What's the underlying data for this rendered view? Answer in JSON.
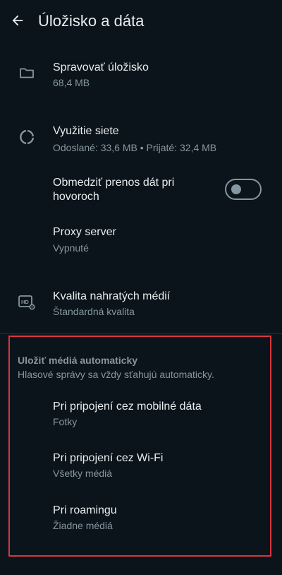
{
  "header": {
    "title": "Úložisko a dáta",
    "back_icon": "arrow-left-icon"
  },
  "storage": {
    "title": "Spravovať úložisko",
    "size": "68,4 MB",
    "icon": "folder-icon"
  },
  "network": {
    "title": "Využitie siete",
    "details": "Odoslané: 33,6 MB • Prijaté: 32,4 MB",
    "icon": "data-usage-icon"
  },
  "call_data": {
    "title_line1": "Obmedziť prenos dát pri",
    "title_line2": "hovoroch",
    "enabled": false
  },
  "proxy": {
    "title": "Proxy server",
    "status": "Vypnuté"
  },
  "upload_quality": {
    "title": "Kvalita nahratých médií",
    "value": "Štandardná kvalita",
    "icon": "hd-settings-icon"
  },
  "auto_download": {
    "header": "Uložiť médiá automaticky",
    "description": "Hlasové správy sa vždy sťahujú automaticky.",
    "items": [
      {
        "title": "Pri pripojení cez mobilné dáta",
        "value": "Fotky"
      },
      {
        "title": "Pri pripojení cez Wi-Fi",
        "value": "Všetky médiá"
      },
      {
        "title": "Pri roamingu",
        "value": "Žiadne médiá"
      }
    ]
  },
  "colors": {
    "background": "#0b141a",
    "primary_text": "#e9edef",
    "secondary_text": "#8696a0",
    "highlight": "#d9363e"
  }
}
